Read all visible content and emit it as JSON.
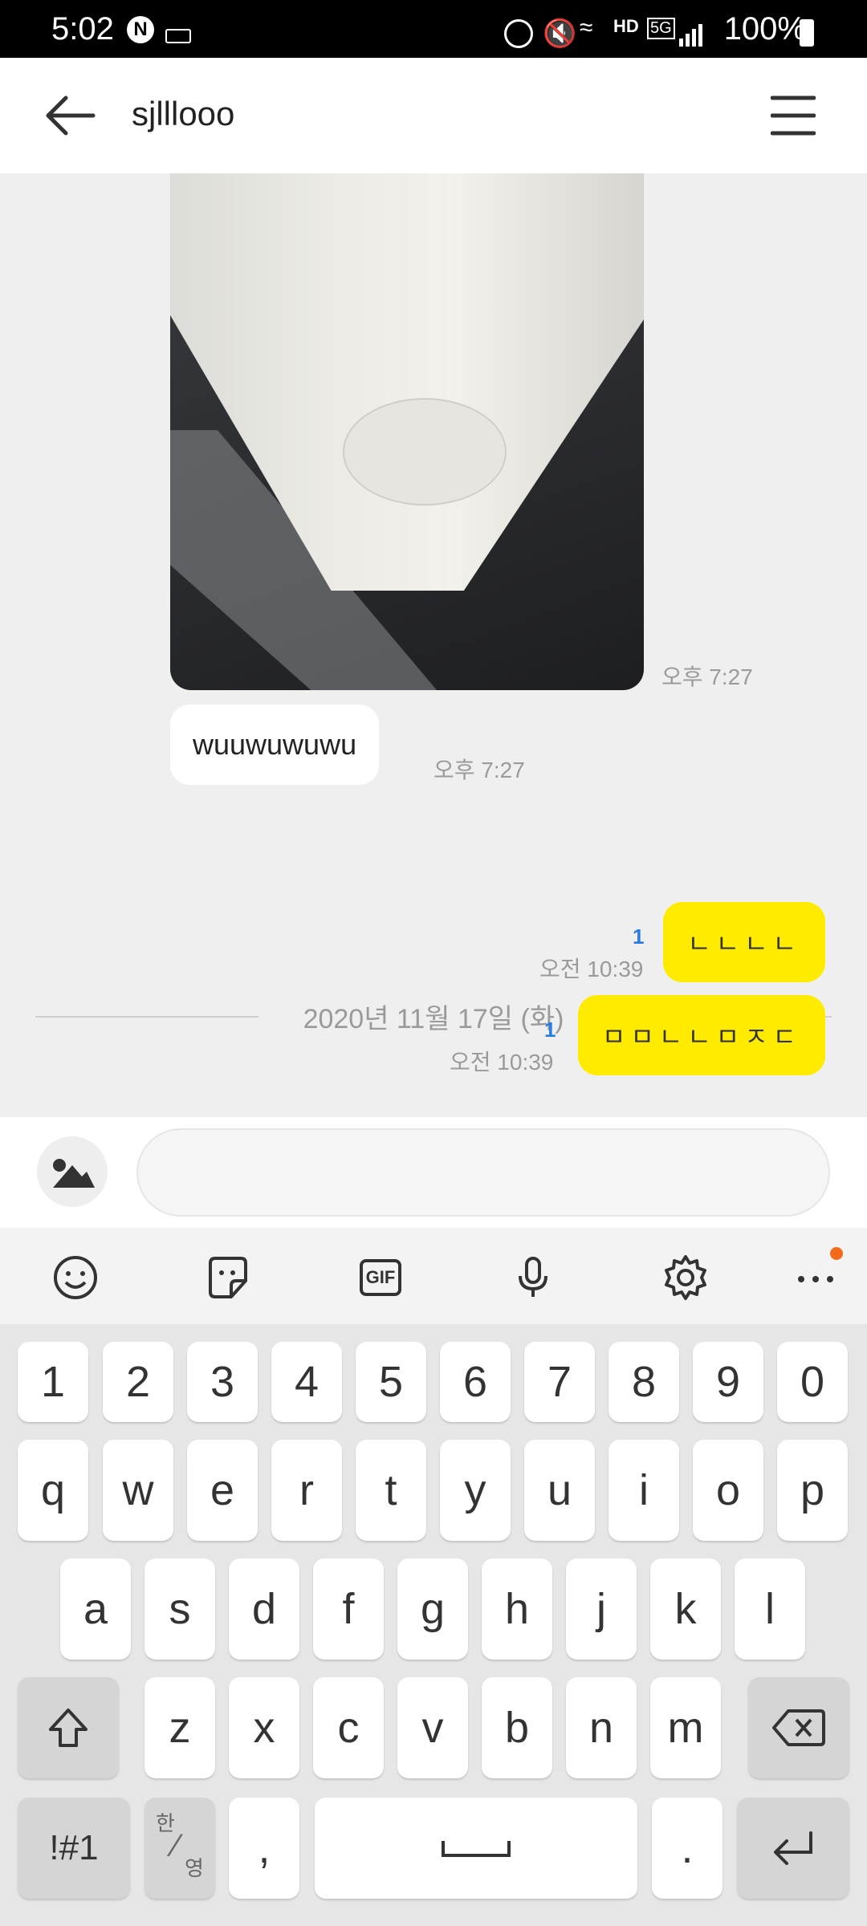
{
  "status_bar": {
    "time": "5:02",
    "battery": "100%"
  },
  "header": {
    "title": "sjlllooo"
  },
  "messages": {
    "photo_time": "오후 7:27",
    "incoming_text": "wuuwuwuwu",
    "incoming_time": "오후 7:27",
    "date_separator": "2020년 11월 17일 (화)",
    "outgoing": [
      {
        "text": "ㄴㄴㄴㄴ",
        "time": "오전 10:39",
        "unread": "1"
      },
      {
        "text": "ㅁㅁㄴㄴㅁㅈㄷ",
        "time": "오전 10:39",
        "unread": "1"
      }
    ]
  },
  "input": {
    "placeholder": ""
  },
  "keyboard": {
    "toolbar": [
      "emoji-icon",
      "sticker-icon",
      "gif-icon",
      "microphone-icon",
      "settings-icon",
      "more-icon"
    ],
    "gif_label": "GIF",
    "numbers": [
      "1",
      "2",
      "3",
      "4",
      "5",
      "6",
      "7",
      "8",
      "9",
      "0"
    ],
    "row1": [
      "q",
      "w",
      "e",
      "r",
      "t",
      "y",
      "u",
      "i",
      "o",
      "p"
    ],
    "row2": [
      "a",
      "s",
      "d",
      "f",
      "g",
      "h",
      "j",
      "k",
      "l"
    ],
    "row3": [
      "z",
      "x",
      "c",
      "v",
      "b",
      "n",
      "m"
    ],
    "symbols_key": "!#1",
    "lang_key_top": "한",
    "lang_key_bottom": "영",
    "comma": ",",
    "period": "."
  },
  "colors": {
    "outgoing_bubble": "#ffeb00",
    "unread_count": "#2a7be0",
    "background": "#efefef"
  }
}
